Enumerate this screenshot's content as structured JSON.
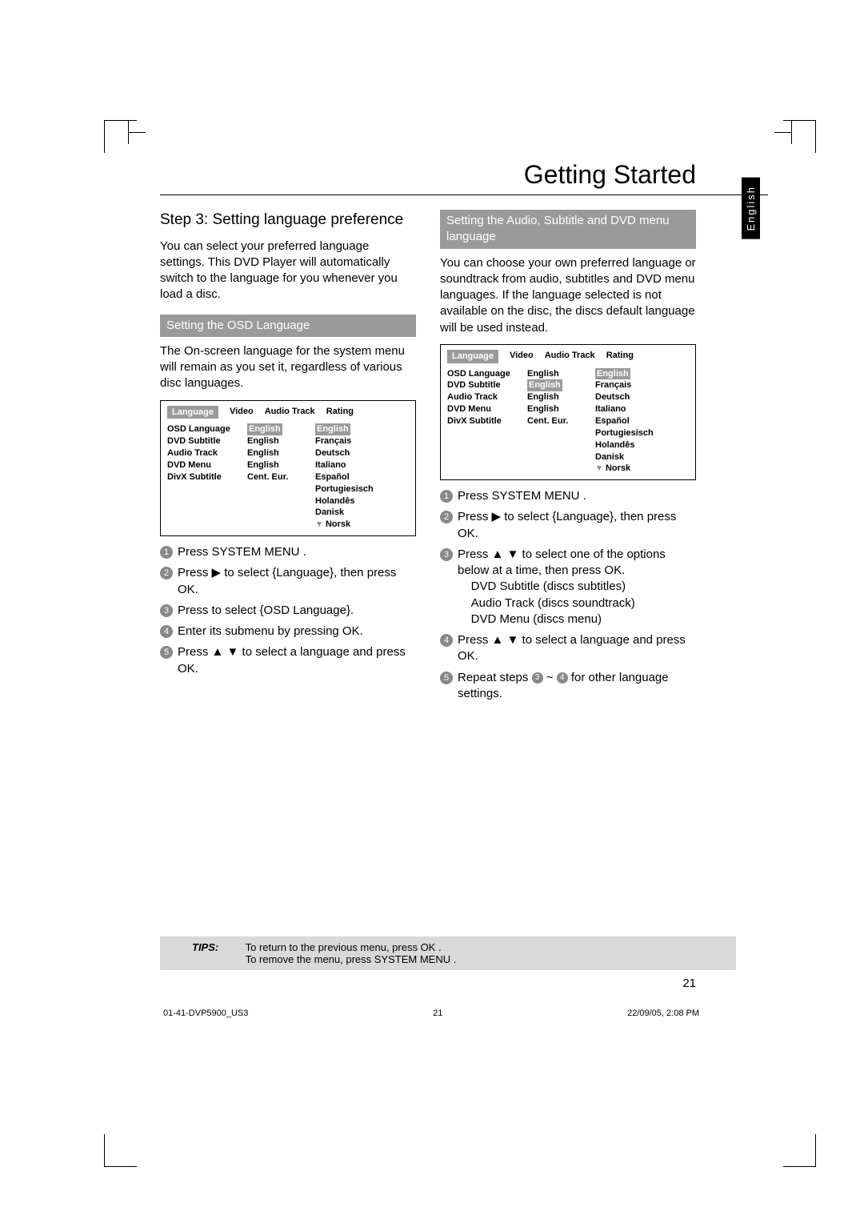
{
  "pageTitle": "Getting Started",
  "langTab": "English",
  "section": {
    "step3": "Step 3:  Setting language preference",
    "intro": "You can select your preferred language settings. This DVD Player will automatically switch to the language for you whenever you load a disc.",
    "osdHeading": "Setting the OSD Language",
    "osdIntro": "The On-screen language for the system menu will remain as you set it, regardless of various disc languages.",
    "audioHeading": "Setting the Audio, Subtitle and DVD menu language",
    "audioIntro": "You can choose your own preferred language or soundtrack from audio, subtitles and DVD menu languages. If the language selected is not available on the disc, the discs default language will be used instead."
  },
  "menu": {
    "tabs": [
      "Language",
      "Video",
      "Audio Track",
      "Rating"
    ],
    "rows": [
      {
        "label": "OSD Language",
        "val": "English"
      },
      {
        "label": "DVD Subtitle",
        "val": "English"
      },
      {
        "label": "Audio Track",
        "val": "English"
      },
      {
        "label": "DVD Menu",
        "val": "English"
      },
      {
        "label": "DivX Subtitle",
        "val": "Cent. Eur."
      }
    ],
    "options": [
      "English",
      "Français",
      "Deutsch",
      "Italiano",
      "Español",
      "Portugiesisch",
      "Holandês",
      "Danisk",
      "Norsk"
    ]
  },
  "stepsLeft": {
    "s1": "Press SYSTEM MENU .",
    "s2": "Press ▶ to select {Language}, then press OK.",
    "s3": "Press         to select {OSD Language}.",
    "s4": "Enter its submenu by pressing OK.",
    "s5": "Press ▲ ▼ to select a language and press OK."
  },
  "stepsRight": {
    "s1": "Press SYSTEM MENU .",
    "s2": "Press ▶ to select {Language}, then press OK.",
    "s3": "Press ▲ ▼ to select one of the options below at a time, then press OK.",
    "s3a": "DVD Subtitle  (discs subtitles)",
    "s3b": "Audio Track  (discs soundtrack)",
    "s3c": "DVD Menu  (discs menu)",
    "s4": "Press ▲ ▼ to select a language and press OK.",
    "s5a": "Repeat steps ",
    "s5b": " ~ ",
    "s5c": " for other language settings."
  },
  "tips": {
    "label": "TIPS:",
    "line1": "To return to the previous menu, press OK .",
    "line2": "To remove the menu, press SYSTEM MENU ."
  },
  "pageNum": "21",
  "footer": {
    "file": "01-41-DVP5900_US3",
    "pg": "21",
    "date": "22/09/05, 2:08 PM"
  }
}
